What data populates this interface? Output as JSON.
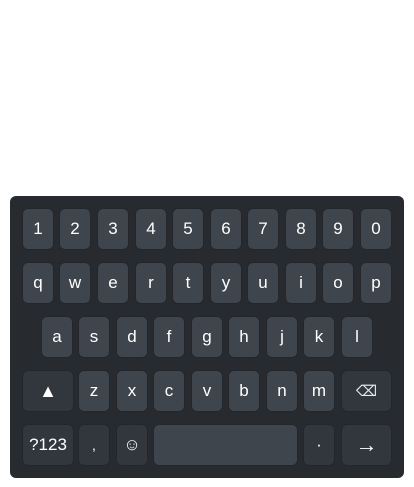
{
  "keyboard": {
    "row_numbers": [
      "1",
      "2",
      "3",
      "4",
      "5",
      "6",
      "7",
      "8",
      "9",
      "0"
    ],
    "row_top": [
      "q",
      "w",
      "e",
      "r",
      "t",
      "y",
      "u",
      "i",
      "o",
      "p"
    ],
    "row_middle": [
      "a",
      "s",
      "d",
      "f",
      "g",
      "h",
      "j",
      "k",
      "l"
    ],
    "row_bottom": [
      "z",
      "x",
      "c",
      "v",
      "b",
      "n",
      "m"
    ],
    "shift": "▲",
    "backspace": "⌫",
    "symbols": "?123",
    "comma": ",",
    "emoji": "☺",
    "space": "",
    "period": "·",
    "enter": "→"
  }
}
